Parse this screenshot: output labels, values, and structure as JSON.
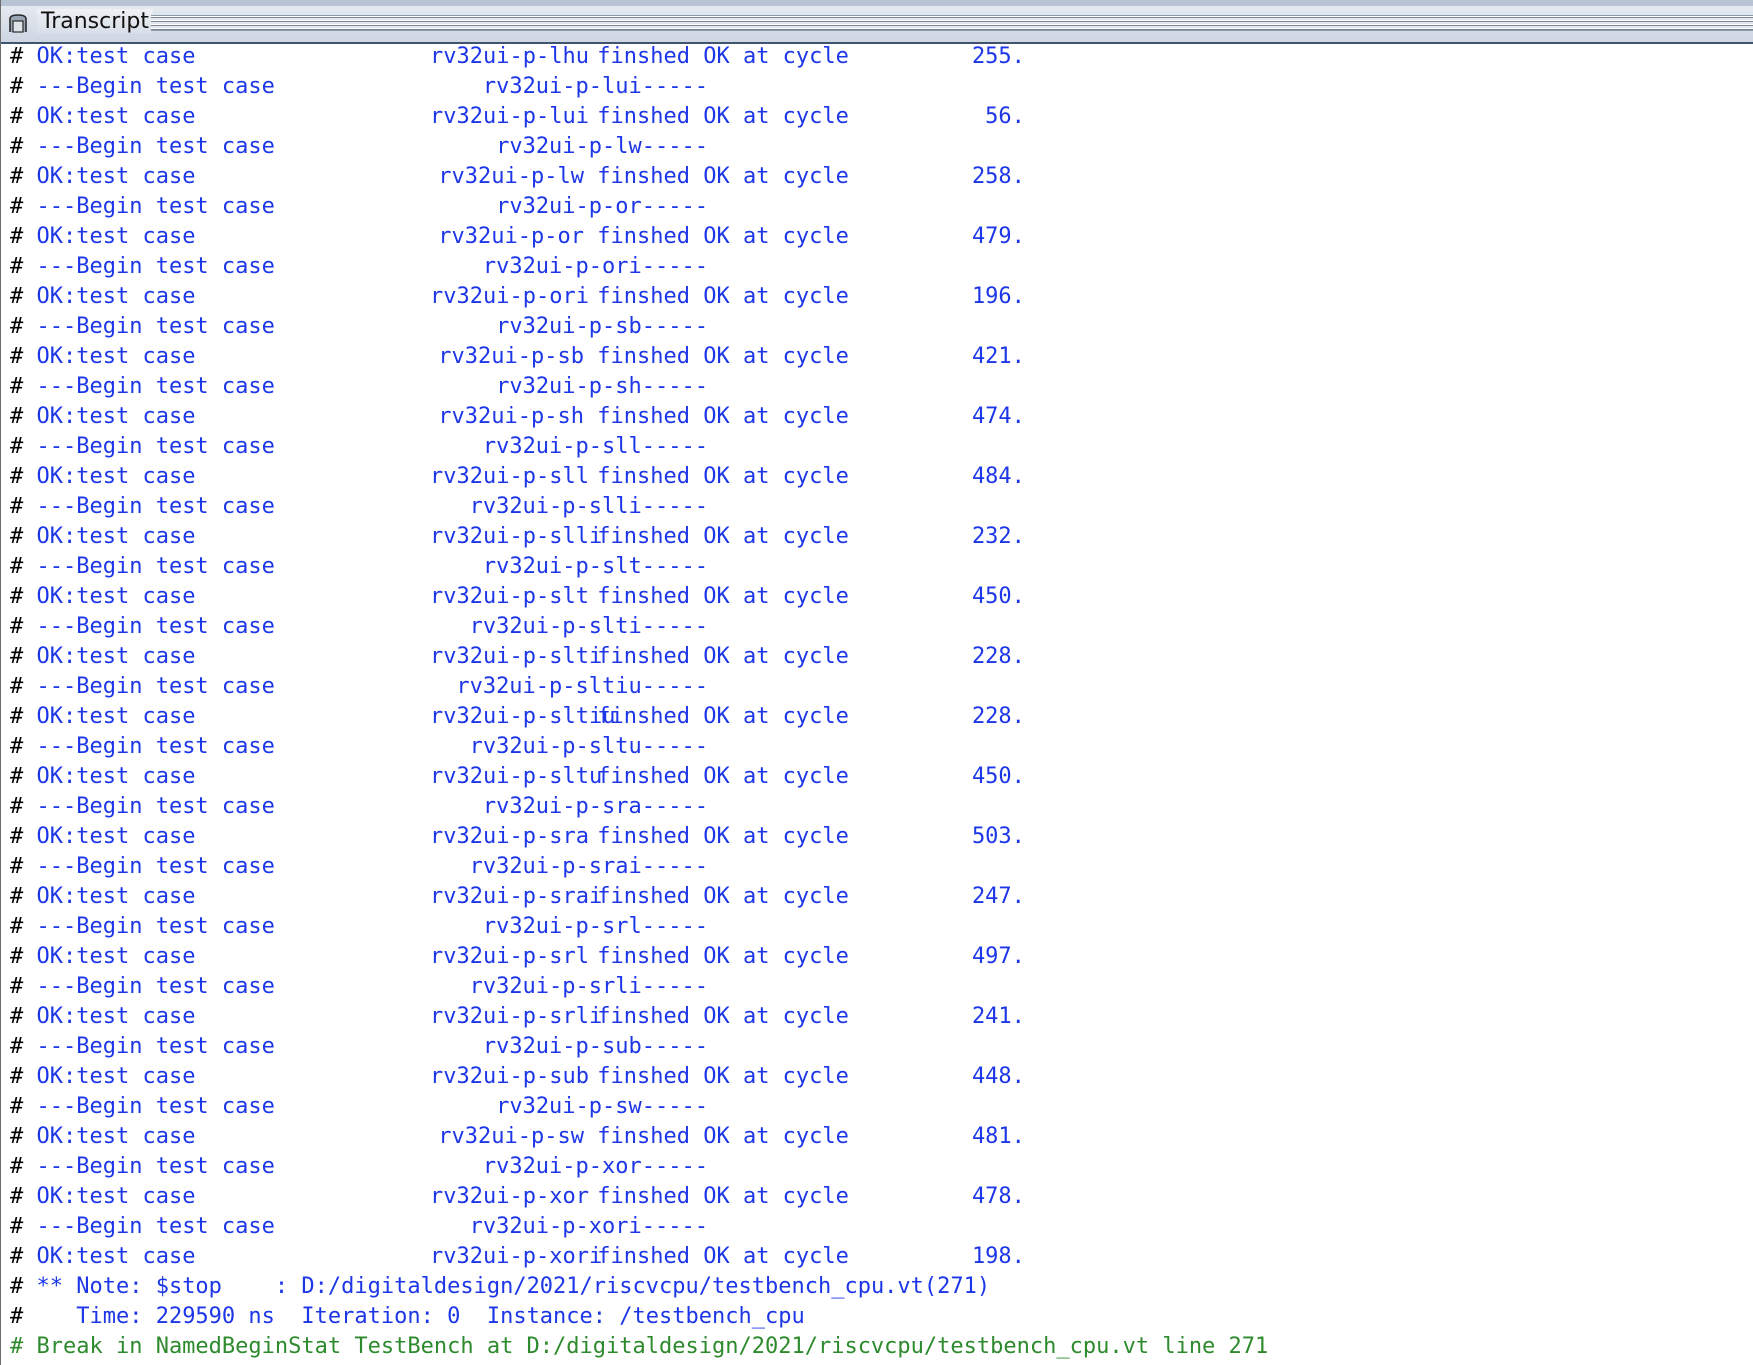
{
  "window": {
    "title": "Transcript"
  },
  "lines": [
    {
      "kind": "ok",
      "prefix": "# OK:test case",
      "name": "rv32ui-p-lhu",
      "suffix": "finshed OK at cycle",
      "cycle": "255."
    },
    {
      "kind": "begin",
      "prefix": "# ---Begin test case",
      "name": "rv32ui-p-lui-----"
    },
    {
      "kind": "ok",
      "prefix": "# OK:test case",
      "name": "rv32ui-p-lui",
      "suffix": "finshed OK at cycle",
      "cycle": "56."
    },
    {
      "kind": "begin",
      "prefix": "# ---Begin test case",
      "name": "rv32ui-p-lw-----"
    },
    {
      "kind": "ok",
      "prefix": "# OK:test case",
      "name": "rv32ui-p-lw",
      "suffix": "finshed OK at cycle",
      "cycle": "258."
    },
    {
      "kind": "begin",
      "prefix": "# ---Begin test case",
      "name": "rv32ui-p-or-----"
    },
    {
      "kind": "ok",
      "prefix": "# OK:test case",
      "name": "rv32ui-p-or",
      "suffix": "finshed OK at cycle",
      "cycle": "479."
    },
    {
      "kind": "begin",
      "prefix": "# ---Begin test case",
      "name": "rv32ui-p-ori-----"
    },
    {
      "kind": "ok",
      "prefix": "# OK:test case",
      "name": "rv32ui-p-ori",
      "suffix": "finshed OK at cycle",
      "cycle": "196."
    },
    {
      "kind": "begin",
      "prefix": "# ---Begin test case",
      "name": "rv32ui-p-sb-----"
    },
    {
      "kind": "ok",
      "prefix": "# OK:test case",
      "name": "rv32ui-p-sb",
      "suffix": "finshed OK at cycle",
      "cycle": "421."
    },
    {
      "kind": "begin",
      "prefix": "# ---Begin test case",
      "name": "rv32ui-p-sh-----"
    },
    {
      "kind": "ok",
      "prefix": "# OK:test case",
      "name": "rv32ui-p-sh",
      "suffix": "finshed OK at cycle",
      "cycle": "474."
    },
    {
      "kind": "begin",
      "prefix": "# ---Begin test case",
      "name": "rv32ui-p-sll-----"
    },
    {
      "kind": "ok",
      "prefix": "# OK:test case",
      "name": "rv32ui-p-sll",
      "suffix": "finshed OK at cycle",
      "cycle": "484."
    },
    {
      "kind": "begin",
      "prefix": "# ---Begin test case",
      "name": "rv32ui-p-slli-----"
    },
    {
      "kind": "ok",
      "prefix": "# OK:test case",
      "name": "rv32ui-p-slli",
      "suffix": "finshed OK at cycle",
      "cycle": "232."
    },
    {
      "kind": "begin",
      "prefix": "# ---Begin test case",
      "name": "rv32ui-p-slt-----"
    },
    {
      "kind": "ok",
      "prefix": "# OK:test case",
      "name": "rv32ui-p-slt",
      "suffix": "finshed OK at cycle",
      "cycle": "450."
    },
    {
      "kind": "begin",
      "prefix": "# ---Begin test case",
      "name": "rv32ui-p-slti-----"
    },
    {
      "kind": "ok",
      "prefix": "# OK:test case",
      "name": "rv32ui-p-slti",
      "suffix": "finshed OK at cycle",
      "cycle": "228."
    },
    {
      "kind": "begin",
      "prefix": "# ---Begin test case",
      "name": "rv32ui-p-sltiu-----"
    },
    {
      "kind": "ok",
      "prefix": "# OK:test case",
      "name": "rv32ui-p-sltiu",
      "suffix": "finshed OK at cycle",
      "cycle": "228."
    },
    {
      "kind": "begin",
      "prefix": "# ---Begin test case",
      "name": "rv32ui-p-sltu-----"
    },
    {
      "kind": "ok",
      "prefix": "# OK:test case",
      "name": "rv32ui-p-sltu",
      "suffix": "finshed OK at cycle",
      "cycle": "450."
    },
    {
      "kind": "begin",
      "prefix": "# ---Begin test case",
      "name": "rv32ui-p-sra-----"
    },
    {
      "kind": "ok",
      "prefix": "# OK:test case",
      "name": "rv32ui-p-sra",
      "suffix": "finshed OK at cycle",
      "cycle": "503."
    },
    {
      "kind": "begin",
      "prefix": "# ---Begin test case",
      "name": "rv32ui-p-srai-----"
    },
    {
      "kind": "ok",
      "prefix": "# OK:test case",
      "name": "rv32ui-p-srai",
      "suffix": "finshed OK at cycle",
      "cycle": "247."
    },
    {
      "kind": "begin",
      "prefix": "# ---Begin test case",
      "name": "rv32ui-p-srl-----"
    },
    {
      "kind": "ok",
      "prefix": "# OK:test case",
      "name": "rv32ui-p-srl",
      "suffix": "finshed OK at cycle",
      "cycle": "497."
    },
    {
      "kind": "begin",
      "prefix": "# ---Begin test case",
      "name": "rv32ui-p-srli-----"
    },
    {
      "kind": "ok",
      "prefix": "# OK:test case",
      "name": "rv32ui-p-srli",
      "suffix": "finshed OK at cycle",
      "cycle": "241."
    },
    {
      "kind": "begin",
      "prefix": "# ---Begin test case",
      "name": "rv32ui-p-sub-----"
    },
    {
      "kind": "ok",
      "prefix": "# OK:test case",
      "name": "rv32ui-p-sub",
      "suffix": "finshed OK at cycle",
      "cycle": "448."
    },
    {
      "kind": "begin",
      "prefix": "# ---Begin test case",
      "name": "rv32ui-p-sw-----"
    },
    {
      "kind": "ok",
      "prefix": "# OK:test case",
      "name": "rv32ui-p-sw",
      "suffix": "finshed OK at cycle",
      "cycle": "481."
    },
    {
      "kind": "begin",
      "prefix": "# ---Begin test case",
      "name": "rv32ui-p-xor-----"
    },
    {
      "kind": "ok",
      "prefix": "# OK:test case",
      "name": "rv32ui-p-xor",
      "suffix": "finshed OK at cycle",
      "cycle": "478."
    },
    {
      "kind": "begin",
      "prefix": "# ---Begin test case",
      "name": "rv32ui-p-xori-----"
    },
    {
      "kind": "ok",
      "prefix": "# OK:test case",
      "name": "rv32ui-p-xori",
      "suffix": "finshed OK at cycle",
      "cycle": "198."
    },
    {
      "kind": "note",
      "text": "# ** Note: $stop    : D:/digitaldesign/2021/riscvcpu/testbench_cpu.vt(271)"
    },
    {
      "kind": "note",
      "text": "#    Time: 229590 ns  Iteration: 0  Instance: /testbench_cpu"
    },
    {
      "kind": "break",
      "text": "# Break in NamedBeginStat TestBench at D:/digitaldesign/2021/riscvcpu/testbench_cpu.vt line 271"
    }
  ],
  "colors": {
    "log_text": "#1c36e8",
    "hash": "#000000",
    "break_text": "#2d8a2d"
  }
}
